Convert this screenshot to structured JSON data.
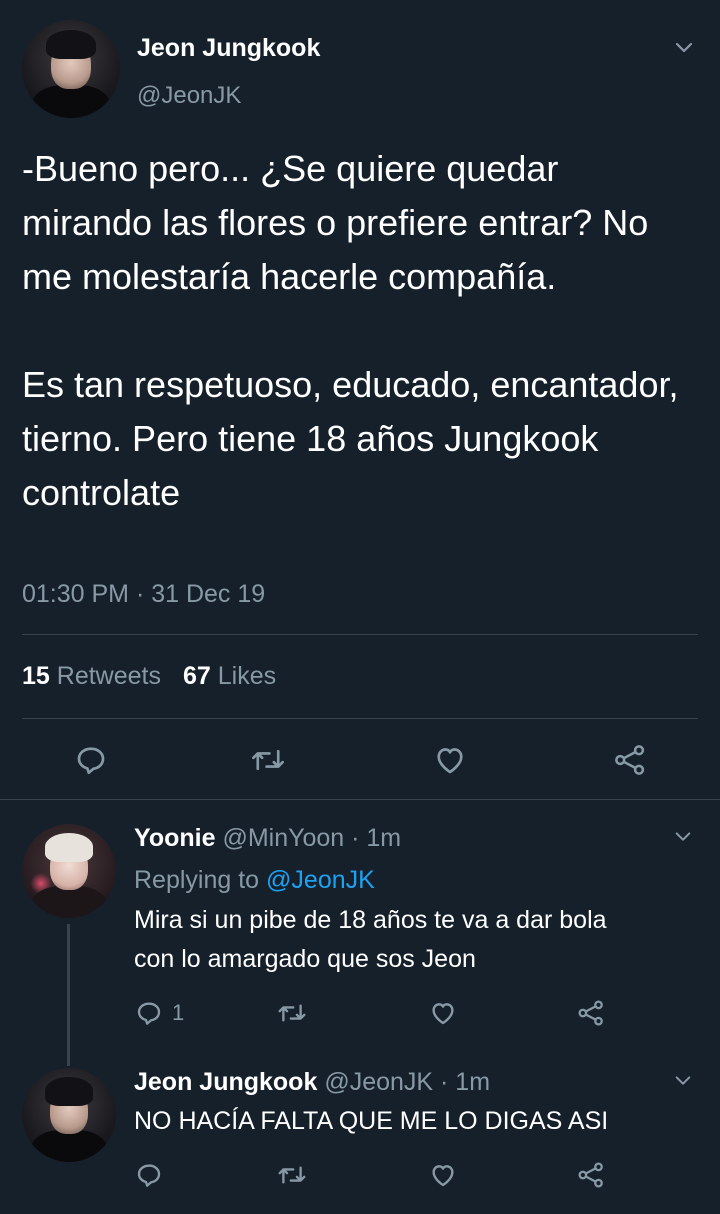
{
  "colors": {
    "background": "#15202b",
    "text": "#ffffff",
    "muted": "#8899a6",
    "link": "#1da1f2",
    "divider": "#38444d"
  },
  "main_tweet": {
    "author_name": "Jeon Jungkook",
    "handle": "@JeonJK",
    "text": "-Bueno pero... ¿Se quiere quedar mirando las flores o prefiere entrar? No me molestaría hacerle compañía.\n\nEs tan respetuoso, educado, encantador, tierno. Pero tiene 18 años Jungkook controlate",
    "timestamp": "01:30 PM · 31 Dec 19",
    "retweets_count": "15",
    "retweets_label": "Retweets",
    "likes_count": "67",
    "likes_label": "Likes",
    "icons": [
      "reply-icon",
      "retweet-icon",
      "like-icon",
      "share-icon",
      "chevron-down-icon"
    ]
  },
  "replies": [
    {
      "author_name": "Yoonie",
      "meta": "@MinYoon · 1m",
      "replying_prefix": "Replying to",
      "replying_to": "@JeonJK",
      "text": "Mira si un pibe de 18 años te va a dar bola\ncon lo amargado que sos Jeon",
      "reply_count": "1"
    },
    {
      "author_name": "Jeon Jungkook",
      "meta": "@JeonJK · 1m",
      "text": "NO HACÍA FALTA QUE ME LO DIGAS ASI"
    }
  ]
}
